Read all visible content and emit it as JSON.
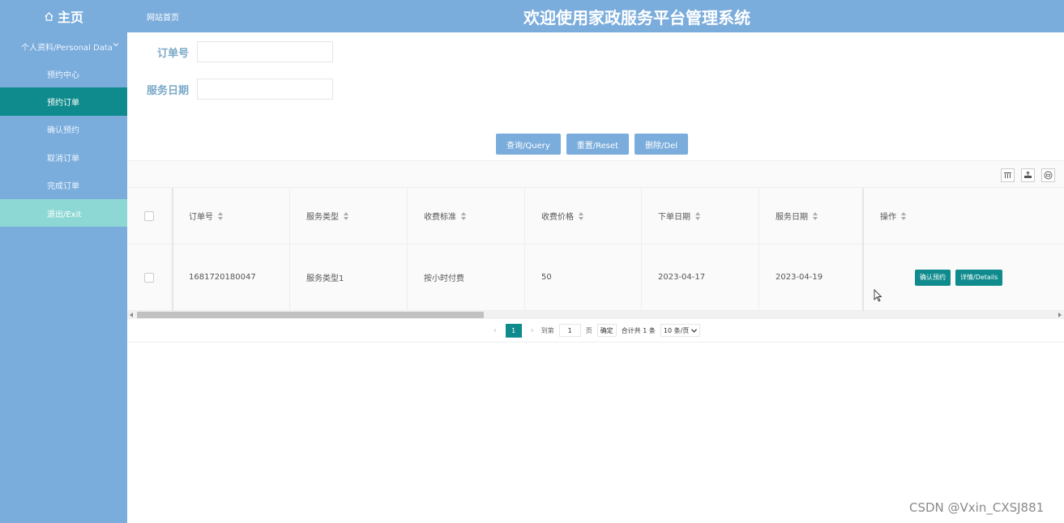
{
  "header": {
    "logo_label": "主页",
    "site_link": "网站首页",
    "title": "欢迎使用家政服务平台管理系统"
  },
  "sidebar": {
    "group_label": "个人资料/Personal Data",
    "items": [
      {
        "label": "预约中心"
      },
      {
        "label": "预约订单"
      },
      {
        "label": "确认预约"
      },
      {
        "label": "取消订单"
      },
      {
        "label": "完成订单"
      },
      {
        "label": "退出/Exit"
      }
    ]
  },
  "search": {
    "order_no_label": "订单号",
    "order_no_value": "",
    "service_date_label": "服务日期",
    "service_date_value": ""
  },
  "actions": {
    "query": "查询/Query",
    "reset": "重置/Reset",
    "delete": "删除/Del"
  },
  "table": {
    "columns": [
      "订单号",
      "服务类型",
      "收费标准",
      "收费价格",
      "下单日期",
      "服务日期",
      "操作"
    ],
    "rows": [
      {
        "order_no": "1681720180047",
        "service_type": "服务类型1",
        "fee_standard": "按小时付费",
        "price": "50",
        "order_date": "2023-04-17",
        "service_date": "2023-04-19",
        "confirm_label": "确认预约",
        "details_label": "详情/Details"
      }
    ]
  },
  "pager": {
    "current_page": "1",
    "goto_label": "到第",
    "goto_value": "1",
    "page_unit": "页",
    "confirm": "确定",
    "total": "合计共 1 条",
    "page_size": "10 条/页"
  },
  "watermark": "CSDN @Vxin_CXSJ881",
  "colors": {
    "header_bg": "#7aacdc",
    "active_bg": "#0f8b8d",
    "exit_bg": "#8dd8d4",
    "label_color": "#7aa9c8"
  }
}
